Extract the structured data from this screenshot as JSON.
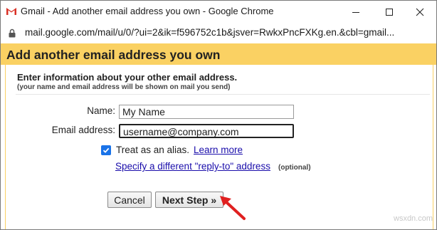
{
  "window": {
    "title": "Gmail - Add another email address you own - Google Chrome"
  },
  "address_bar": {
    "url": "mail.google.com/mail/u/0/?ui=2&ik=f596752c1b&jsver=RwkxPncFXKg.en.&cbl=gmail..."
  },
  "dialog": {
    "title": "Add another email address you own",
    "intro": "Enter information about your other email address.",
    "intro_note": "(your name and email address will be shown on mail you send)",
    "name_label": "Name:",
    "name_value": "My Name",
    "email_label": "Email address:",
    "email_value": "username@company.com",
    "alias_label": "Treat as an alias.",
    "alias_checked": true,
    "learn_more": "Learn more",
    "reply_to_link": "Specify a different \"reply-to\" address",
    "optional_note": "(optional)",
    "cancel_label": "Cancel",
    "next_label": "Next Step »"
  },
  "watermark": "wsxdn.com",
  "colors": {
    "header_bg": "#fad163",
    "link": "#1a0dab",
    "checkbox": "#1a73e8",
    "arrow": "#e02020"
  }
}
